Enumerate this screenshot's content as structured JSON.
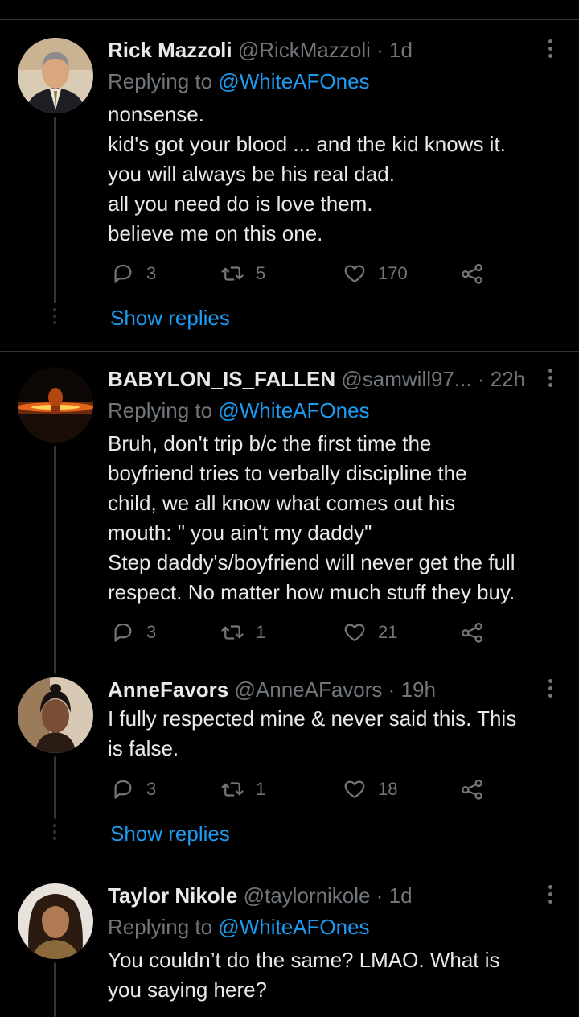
{
  "tweets": [
    {
      "name": "Rick Mazzoli",
      "handle": "@RickMazzoli",
      "time": "1d",
      "replying_prefix": "Replying to",
      "replying_to": "@WhiteAFOnes",
      "lines": [
        "nonsense.",
        "kid's got your blood ... and the kid knows it.",
        "you will always be his real dad.",
        "all you need do is love them.",
        "believe me on this one."
      ],
      "replies": "3",
      "retweets": "5",
      "likes": "170",
      "show_replies": "Show replies"
    },
    {
      "name": "BABYLON_IS_FALLEN",
      "handle": "@samwill97...",
      "time": "22h",
      "replying_prefix": "Replying to",
      "replying_to": "@WhiteAFOnes",
      "lines": [
        "Bruh, don't trip b/c the first time the",
        "boyfriend tries to verbally discipline the",
        "child, we all know what comes out his",
        "mouth: \" you ain't my daddy\"",
        "Step daddy's/boyfriend will never get the full",
        "respect. No matter how much stuff they buy."
      ],
      "replies": "3",
      "retweets": "1",
      "likes": "21"
    },
    {
      "name": "AnneFavors",
      "handle": "@AnneAFavors",
      "time": "19h",
      "lines": [
        "I fully respected mine & never said this. This",
        "is false."
      ],
      "replies": "3",
      "retweets": "1",
      "likes": "18",
      "show_replies": "Show replies"
    },
    {
      "name": "Taylor Nikole",
      "handle": "@taylornikole",
      "time": "1d",
      "replying_prefix": "Replying to",
      "replying_to": "@WhiteAFOnes",
      "lines": [
        "You couldn’t do the same? LMAO. What is",
        "you saying here?"
      ]
    }
  ],
  "colors": {
    "background": "#000000",
    "text": "#e7e9ea",
    "secondary": "#71767b",
    "accent": "#1d9bf0",
    "border": "#2f3336"
  },
  "icons": [
    "reply-icon",
    "retweet-icon",
    "like-icon",
    "share-icon",
    "more-icon"
  ]
}
